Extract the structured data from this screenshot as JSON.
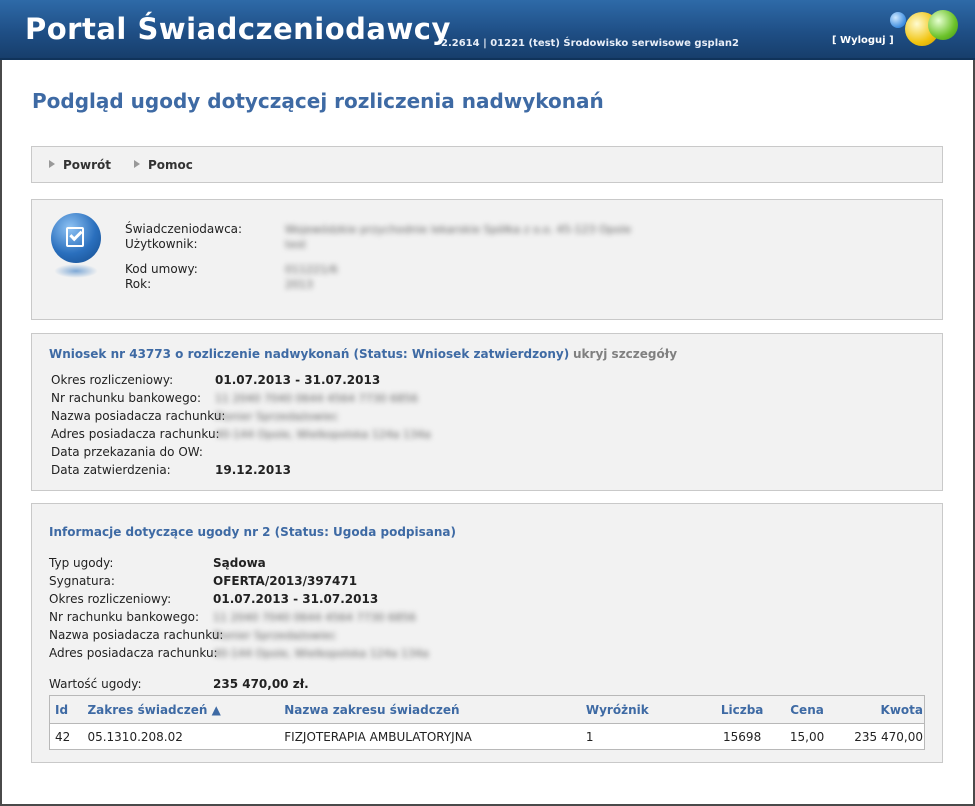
{
  "header": {
    "title": "Portal Świadczeniodawcy",
    "env_info": "2.2614 | 01221 (test) Środowisko serwisowe gsplan2",
    "logout": "[ Wyloguj ]"
  },
  "page_title": "Podgląd ugody dotyczącej rozliczenia nadwykonań",
  "toolbar": {
    "back": "Powrót",
    "help": "Pomoc"
  },
  "info": {
    "provider_label": "Świadczeniodawca:",
    "provider_value": "Wojewódzkie przychodnie lekarskie Spółka z o.o. 45-123 Opole",
    "user_label": "Użytkownik:",
    "user_value": "test",
    "contract_label": "Kod umowy:",
    "contract_value": "011221/6",
    "year_label": "Rok:",
    "year_value": "2013"
  },
  "wniosek": {
    "title": "Wniosek nr 43773 o rozliczenie nadwykonań (Status: Wniosek zatwierdzony)",
    "hide_details": "ukryj szczegóły",
    "fields": [
      {
        "label": "Okres rozliczeniowy:",
        "value": "01.07.2013 - 31.07.2013"
      },
      {
        "label": "Nr rachunku bankowego:",
        "value": "11 2040 7040 0644 4564 7730 6856"
      },
      {
        "label": "Nazwa posiadacza rachunku:",
        "value": "Pionier Sprzedażowiec"
      },
      {
        "label": "Adres posiadacza rachunku:",
        "value": "40-144 Opole, Wielkopolska 124a 134a"
      },
      {
        "label": "Data przekazania do OW:",
        "value": ""
      },
      {
        "label": "Data zatwierdzenia:",
        "value": "19.12.2013"
      }
    ]
  },
  "ugoda": {
    "title": "Informacje dotyczące ugody nr 2 (Status: Ugoda podpisana)",
    "fields": [
      {
        "label": "Typ ugody:",
        "value": "Sądowa"
      },
      {
        "label": "Sygnatura:",
        "value": "OFERTA/2013/397471"
      },
      {
        "label": "Okres rozliczeniowy:",
        "value": "01.07.2013 - 31.07.2013"
      },
      {
        "label": "Nr rachunku bankowego:",
        "value": "11 2040 7040 0644 4564 7730 6856"
      },
      {
        "label": "Nazwa posiadacza rachunku:",
        "value": "Pionier Sprzedażowiec"
      },
      {
        "label": "Adres posiadacza rachunku:",
        "value": "40-144 Opole, Wielkopolska 124a 134a"
      }
    ],
    "value_label": "Wartość ugody:",
    "value_value": "235 470,00 zł.",
    "table": {
      "headers": [
        "Id",
        "Zakres świadczeń ▲",
        "Nazwa zakresu świadczeń",
        "Wyróżnik",
        "Liczba",
        "Cena",
        "Kwota"
      ],
      "rows": [
        [
          "42",
          "05.1310.208.02",
          "FIZJOTERAPIA AMBULATORYJNA",
          "1",
          "15698",
          "15,00",
          "235 470,00"
        ]
      ]
    }
  }
}
